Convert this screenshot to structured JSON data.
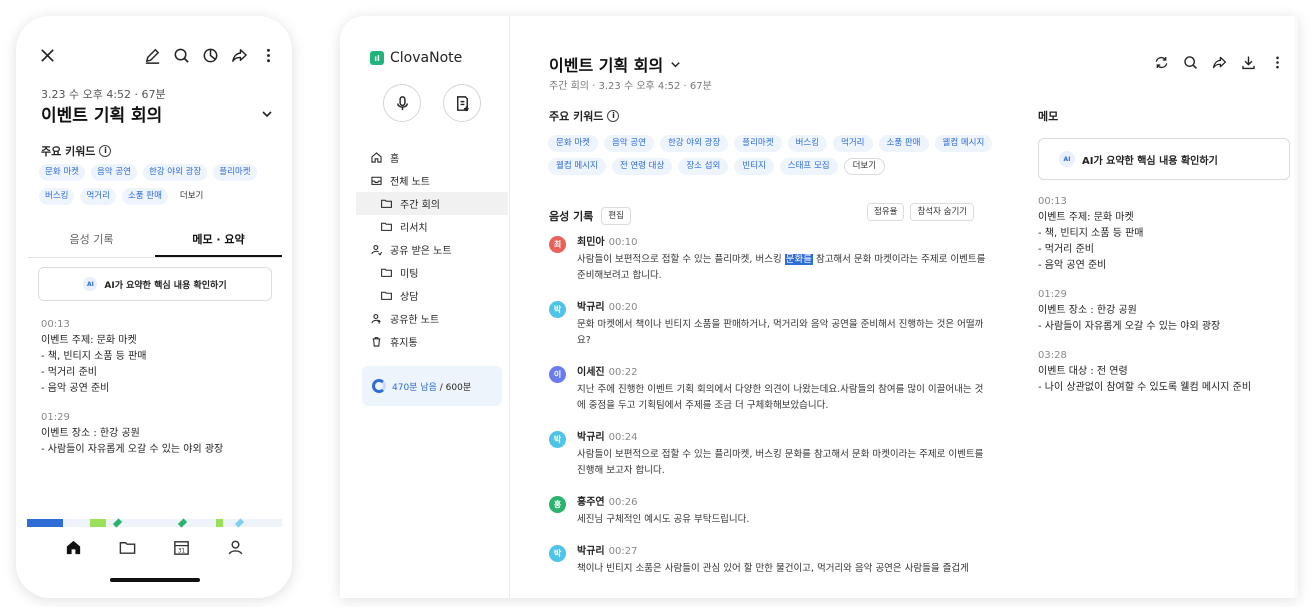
{
  "mobile": {
    "meta": "3.23 수 오후 4:52 · 67분",
    "title": "이벤트 기획 회의",
    "keywords_label": "주요 키워드",
    "keywords": [
      "문화 마켓",
      "음악 공연",
      "한강 야외 광장",
      "플리마켓",
      "버스킹",
      "먹거리",
      "소품 판매"
    ],
    "more_label": "더보기",
    "tabs": [
      "음성 기록",
      "메모 · 요약"
    ],
    "active_tab": "메모 · 요약",
    "ai_button": "AI가 요약한 핵심 내용 확인하기",
    "memos": [
      {
        "time": "00:13",
        "lines": [
          "이벤트 주제: 문화 마켓",
          "- 책, 빈티지 소품 등 판매",
          "- 먹거리 준비",
          "- 음악 공연 준비"
        ]
      },
      {
        "time": "01:29",
        "lines": [
          "이벤트 장소 : 한강 공원",
          "- 사람들이 자유롭게 오갈 수 있는 야외 광장"
        ]
      }
    ],
    "nav_icons": [
      "home-icon",
      "folder-icon",
      "calendar-icon",
      "profile-icon"
    ],
    "calendar_day": "31"
  },
  "desktop": {
    "app_name": "ClovaNote",
    "sidebar": {
      "items": [
        {
          "label": "홈",
          "icon": "home-icon",
          "sub": false,
          "active": false
        },
        {
          "label": "전체 노트",
          "icon": "inbox-icon",
          "sub": false,
          "active": false
        },
        {
          "label": "주간 회의",
          "icon": "folder-icon",
          "sub": true,
          "active": true
        },
        {
          "label": "리서치",
          "icon": "folder-icon",
          "sub": true,
          "active": false
        },
        {
          "label": "공유 받은 노트",
          "icon": "shared-user-icon",
          "sub": false,
          "active": false
        },
        {
          "label": "미팅",
          "icon": "folder-icon",
          "sub": true,
          "active": false
        },
        {
          "label": "상담",
          "icon": "folder-icon",
          "sub": true,
          "active": false
        },
        {
          "label": "공유한 노트",
          "icon": "share-user-icon",
          "sub": false,
          "active": false
        },
        {
          "label": "휴지통",
          "icon": "trash-icon",
          "sub": false,
          "active": false
        }
      ],
      "storage_remaining": "470분 남음",
      "storage_total": " / 600분"
    },
    "note": {
      "title": "이벤트 기획 회의",
      "meta": "주간 회의 · 3.23 수 오후 4:52 · 67분",
      "keywords_label": "주요 키워드",
      "keywords": [
        "문화 마켓",
        "음악 공연",
        "한강 야외 광장",
        "플리마켓",
        "버스킹",
        "먹거리",
        "소품 판매",
        "웰컴 메시지",
        "웰컴 메시지",
        "전 연령 대상",
        "장소 섭외",
        "빈티지",
        "스태프 모집"
      ],
      "more_label": "더보기",
      "recording_label": "음성 기록",
      "edit_label": "편집",
      "share_ratio_label": "점유율",
      "hide_participants_label": "참석자 숨기기",
      "transcript": [
        {
          "avatar": "최",
          "color": "#e8615a",
          "speaker": "최민아",
          "time": "00:10",
          "pre": "사람들이 보편적으로 접할 수 있는 플리마켓, 버스킹 ",
          "highlight": "문화를",
          "post": " 참고해서 문화 마켓이라는 주제로 이벤트를 준비해보려고 합니다."
        },
        {
          "avatar": "박",
          "color": "#4fc3e8",
          "speaker": "박규리",
          "time": "00:20",
          "pre": "문화 마켓에서 책이나 빈티지 소품을 판매하거나, 먹거리와 음악 공연을 준비해서 진행하는 것은 어떨까요?",
          "highlight": "",
          "post": ""
        },
        {
          "avatar": "이",
          "color": "#6b7cf0",
          "speaker": "이세진",
          "time": "00:22",
          "pre": "지난 주에 진행한 이벤트 기획 회의에서 다양한 의견이 나왔는데요.사람들의 참여를 많이 이끌어내는 것에 중점을 두고 기획팀에서 주제를 조금 더 구체화해보았습니다.",
          "highlight": "",
          "post": ""
        },
        {
          "avatar": "박",
          "color": "#4fc3e8",
          "speaker": "박규리",
          "time": "00:24",
          "pre": "사람들이 보편적으로 접할 수 있는 플리마켓, 버스킹 문화를 참고해서 문화 마켓이라는 주제로 이벤트를 진행해 보고자 합니다.",
          "highlight": "",
          "post": ""
        },
        {
          "avatar": "홍",
          "color": "#29b36c",
          "speaker": "홍주연",
          "time": "00:26",
          "pre": "세진님 구체적인 예시도 공유 부탁드립니다.",
          "highlight": "",
          "post": ""
        },
        {
          "avatar": "박",
          "color": "#4fc3e8",
          "speaker": "박규리",
          "time": "00:27",
          "pre": "책이나 빈티지 소품은 사람들이 관심 있어 할 만한 물건이고, 먹거리와 음악 공연은 사람들을 즐겁게",
          "highlight": "",
          "post": ""
        }
      ],
      "memo_label": "메모",
      "ai_button": "AI가 요약한 핵심 내용 확인하기",
      "memos": [
        {
          "time": "00:13",
          "lines": [
            "이벤트 주제: 문화 마켓",
            "- 책, 빈티지 소품 등 판매",
            "- 먹거리 준비",
            "- 음악 공연 준비"
          ]
        },
        {
          "time": "01:29",
          "lines": [
            "이벤트 장소 : 한강 공원",
            "- 사람들이 자유롭게 오갈 수 있는 야외 광장"
          ]
        },
        {
          "time": "03:28",
          "lines": [
            "이벤트 대상 : 전 연령",
            "- 나이 상관없이 참여할 수 있도록 웰컴 메시지 준비"
          ]
        }
      ]
    }
  },
  "ai_badge": "AI",
  "colors": {
    "accent": "#2f6dd6",
    "chip_bg": "#eef4fc",
    "logo": "#1fb57a"
  }
}
